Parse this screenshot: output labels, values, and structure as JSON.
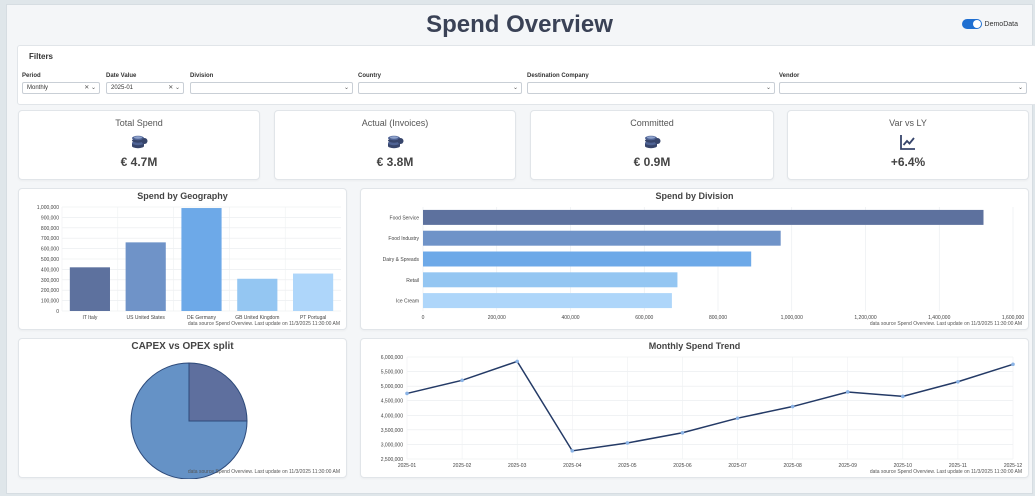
{
  "header": {
    "title": "Spend Overview",
    "demo_toggle_label": "DemoData"
  },
  "filters": {
    "title": "Filters",
    "period": {
      "label": "Period",
      "value": "Monthly"
    },
    "date_value": {
      "label": "Date Value",
      "value": "2025-01"
    },
    "division": {
      "label": "Division",
      "value": ""
    },
    "country": {
      "label": "Country",
      "value": ""
    },
    "destination_company": {
      "label": "Destination Company",
      "value": ""
    },
    "vendor": {
      "label": "Vendor",
      "value": ""
    }
  },
  "kpis": [
    {
      "title": "Total Spend",
      "value": "€ 4.7M",
      "icon": "coins-icon"
    },
    {
      "title": "Actual (Invoices)",
      "value": "€ 3.8M",
      "icon": "coins-icon"
    },
    {
      "title": "Committed",
      "value": "€ 0.9M",
      "icon": "coins-icon"
    },
    {
      "title": "Var vs LY",
      "value": "+6.4%",
      "icon": "trend-chart-icon"
    }
  ],
  "source_note": "data source Spend Overview. Last update on 11/3/2025 11:30:00 AM",
  "colors": {
    "dark_blue": "#5d719e",
    "mid_blue": "#6f93c8",
    "bright_blue": "#6da9e8",
    "light_blue": "#94c6f2",
    "pale_blue": "#aed6fa",
    "line": "#243a66",
    "pie_main": "#6592c6",
    "pie_slice": "#5e6f9e"
  },
  "chart_data": [
    {
      "type": "bar",
      "title": "Spend by Geography",
      "categories": [
        "IT Italy",
        "US United States",
        "DE Germany",
        "GB United Kingdom",
        "PT Portugal"
      ],
      "values": [
        420000,
        660000,
        990000,
        310000,
        360000
      ],
      "ylim": [
        0,
        1000000
      ],
      "yticks": [
        "0",
        "100,000",
        "200,000",
        "300,000",
        "400,000",
        "500,000",
        "600,000",
        "700,000",
        "800,000",
        "900,000",
        "1,000,000"
      ]
    },
    {
      "type": "bar",
      "orientation": "horizontal",
      "title": "Spend by Division",
      "categories": [
        "Food Service",
        "Food Industry",
        "Dairy & Spreads",
        "Retail",
        "Ice Cream"
      ],
      "values": [
        1520000,
        970000,
        890000,
        690000,
        675000
      ],
      "xlim": [
        0,
        1600000
      ],
      "xticks": [
        "0",
        "200,000",
        "400,000",
        "600,000",
        "800,000",
        "1,000,000",
        "1,200,000",
        "1,400,000",
        "1,600,000"
      ]
    },
    {
      "type": "pie",
      "title": "CAPEX vs OPEX split",
      "values": [
        75,
        25
      ]
    },
    {
      "type": "line",
      "title": "Monthly Spend Trend",
      "x": [
        "2025-01",
        "2025-02",
        "2025-03",
        "2025-04",
        "2025-05",
        "2025-06",
        "2025-07",
        "2025-08",
        "2025-09",
        "2025-10",
        "2025-11",
        "2025-12"
      ],
      "values": [
        4750000,
        5200000,
        5850000,
        2780000,
        3050000,
        3400000,
        3900000,
        4300000,
        4800000,
        4650000,
        5150000,
        5750000
      ],
      "ylim": [
        2500000,
        6000000
      ],
      "yticks": [
        "2,500,000",
        "3,000,000",
        "3,500,000",
        "4,000,000",
        "4,500,000",
        "5,000,000",
        "5,500,000",
        "6,000,000"
      ]
    }
  ]
}
